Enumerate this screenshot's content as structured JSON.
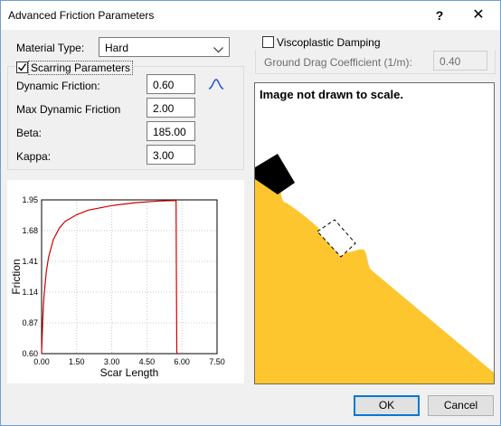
{
  "window": {
    "title": "Advanced Friction Parameters",
    "help_label": "?",
    "close_label": "✕"
  },
  "material": {
    "label": "Material Type:",
    "value": "Hard"
  },
  "scarring": {
    "checkbox_label": "Scarring Parameters",
    "checked": true,
    "fields": [
      {
        "label": "Dynamic Friction:",
        "value": "0.60"
      },
      {
        "label": "Max Dynamic Friction",
        "value": "2.00"
      },
      {
        "label": "Beta:",
        "value": "185.00"
      },
      {
        "label": "Kappa:",
        "value": "3.00"
      }
    ]
  },
  "viscoplastic": {
    "checkbox_label": "Viscoplastic Damping",
    "checked": false,
    "drag_label": "Ground Drag Coefficient (1/m):",
    "drag_value": "0.40"
  },
  "diagram": {
    "note": "Image not drawn to scale.",
    "colors": {
      "slope": "#fdc62f",
      "block": "#000000"
    }
  },
  "buttons": {
    "ok": "OK",
    "cancel": "Cancel"
  },
  "chart_data": {
    "type": "line",
    "xlabel": "Scar Length",
    "ylabel": "Friction",
    "xlim": [
      0,
      7.5
    ],
    "ylim": [
      0.6,
      1.95
    ],
    "x_ticks": [
      "0.00",
      "1.50",
      "3.00",
      "4.50",
      "6.00",
      "7.50"
    ],
    "y_ticks": [
      "0.60",
      "0.87",
      "1.14",
      "1.41",
      "1.68",
      "1.95"
    ],
    "grid": true,
    "line_color": "#d00000",
    "series": [
      {
        "x": [
          0,
          0.05,
          0.1,
          0.2,
          0.3,
          0.5,
          0.75,
          1.0,
          1.5,
          2.0,
          3.0,
          4.0,
          5.0,
          5.75,
          5.76,
          5.78,
          5.8
        ],
        "y": [
          0.6,
          0.9,
          1.1,
          1.32,
          1.45,
          1.6,
          1.7,
          1.76,
          1.82,
          1.86,
          1.9,
          1.925,
          1.94,
          1.945,
          1.4,
          0.62,
          0.6
        ]
      }
    ]
  }
}
